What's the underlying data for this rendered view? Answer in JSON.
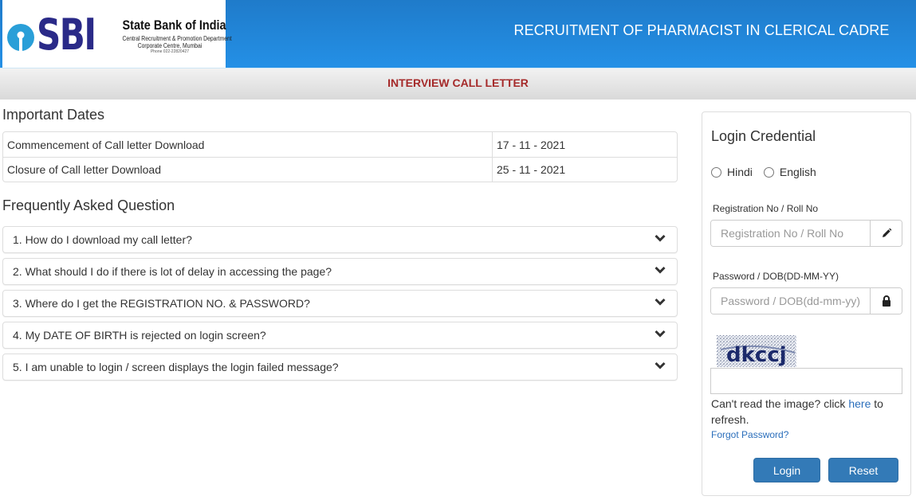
{
  "header": {
    "logo_text": "SBI",
    "bank_name": "State Bank of India",
    "department": "Central Recruitment & Promotion Department",
    "location": "Corporate Centre, Mumbai",
    "phone": "Phone 022-22820427",
    "title": "RECRUITMENT OF PHARMACIST IN CLERICAL CADRE"
  },
  "subheader": {
    "title": "INTERVIEW CALL LETTER"
  },
  "important_dates": {
    "title": "Important Dates",
    "rows": [
      {
        "label": "Commencement of Call letter Download",
        "date": "17 - 11 - 2021"
      },
      {
        "label": "Closure of Call letter Download",
        "date": "25 - 11 - 2021"
      }
    ]
  },
  "faq": {
    "title": "Frequently Asked Question",
    "items": [
      {
        "question": "1. How do I download my call letter?"
      },
      {
        "question": "2. What should I do if there is lot of delay in accessing the page?"
      },
      {
        "question": "3. Where do I get the REGISTRATION NO. & PASSWORD?"
      },
      {
        "question": "4. My DATE OF BIRTH is rejected on login screen?"
      },
      {
        "question": "5. I am unable to login / screen displays the login failed message?"
      }
    ]
  },
  "login": {
    "title": "Login Credential",
    "languages": [
      {
        "label": "Hindi",
        "checked": false
      },
      {
        "label": "English",
        "checked": false
      }
    ],
    "registration": {
      "label": "Registration No / Roll No",
      "placeholder": "Registration No / Roll No",
      "value": "",
      "icon": "pencil-icon"
    },
    "password": {
      "label": "Password / DOB(DD-MM-YY)",
      "placeholder": "Password / DOB(dd-mm-yy)",
      "value": "",
      "icon": "lock-icon"
    },
    "captcha": {
      "text": "dkccj",
      "value": ""
    },
    "captcha_help_prefix": "Can't read the image? click ",
    "captcha_help_link": "here",
    "captcha_help_suffix": " to refresh.",
    "forgot_password": "Forgot Password?",
    "login_button": "Login",
    "reset_button": "Reset"
  },
  "colors": {
    "header_blue": "#1f7bca",
    "subheader_title": "#a52a2a",
    "button_blue": "#337ab7",
    "link_blue": "#2a6ebb",
    "captcha_text": "#1c2a6b"
  }
}
